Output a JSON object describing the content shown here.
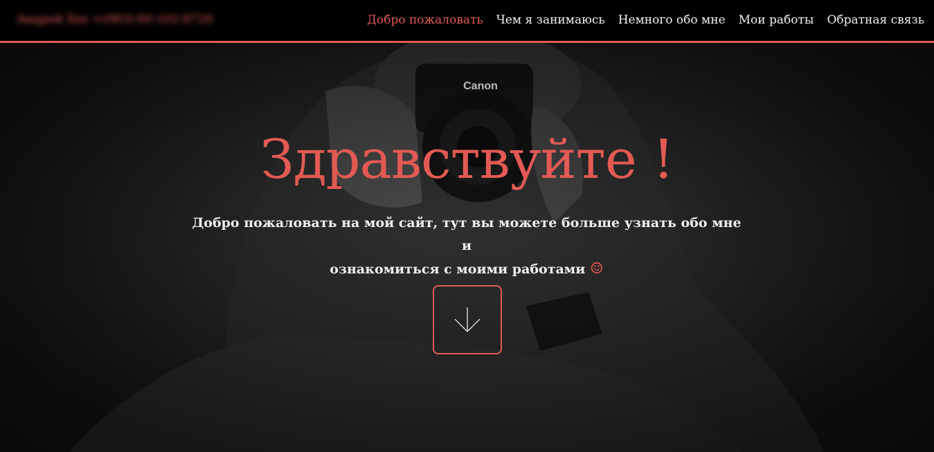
{
  "header": {
    "brand": "Андрей Ххх +(063)-60-102-8720",
    "nav": [
      {
        "label": "Добро пожаловать",
        "active": true
      },
      {
        "label": "Чем я занимаюсь",
        "active": false
      },
      {
        "label": "Немного обо мне",
        "active": false
      },
      {
        "label": "Мои работы",
        "active": false
      },
      {
        "label": "Обратная связь",
        "active": false
      }
    ]
  },
  "hero": {
    "title": "Здравствуйте !",
    "line1": "Добро пожаловать на мой сайт, тут вы можете больше узнать обо мне и",
    "line2": "ознакомиться с моими работами",
    "smile_icon": "smile-icon",
    "scroll_icon": "arrow-down-icon",
    "camera_brand": "Canon"
  },
  "colors": {
    "accent": "#e35a54",
    "header_bg": "#000000"
  }
}
